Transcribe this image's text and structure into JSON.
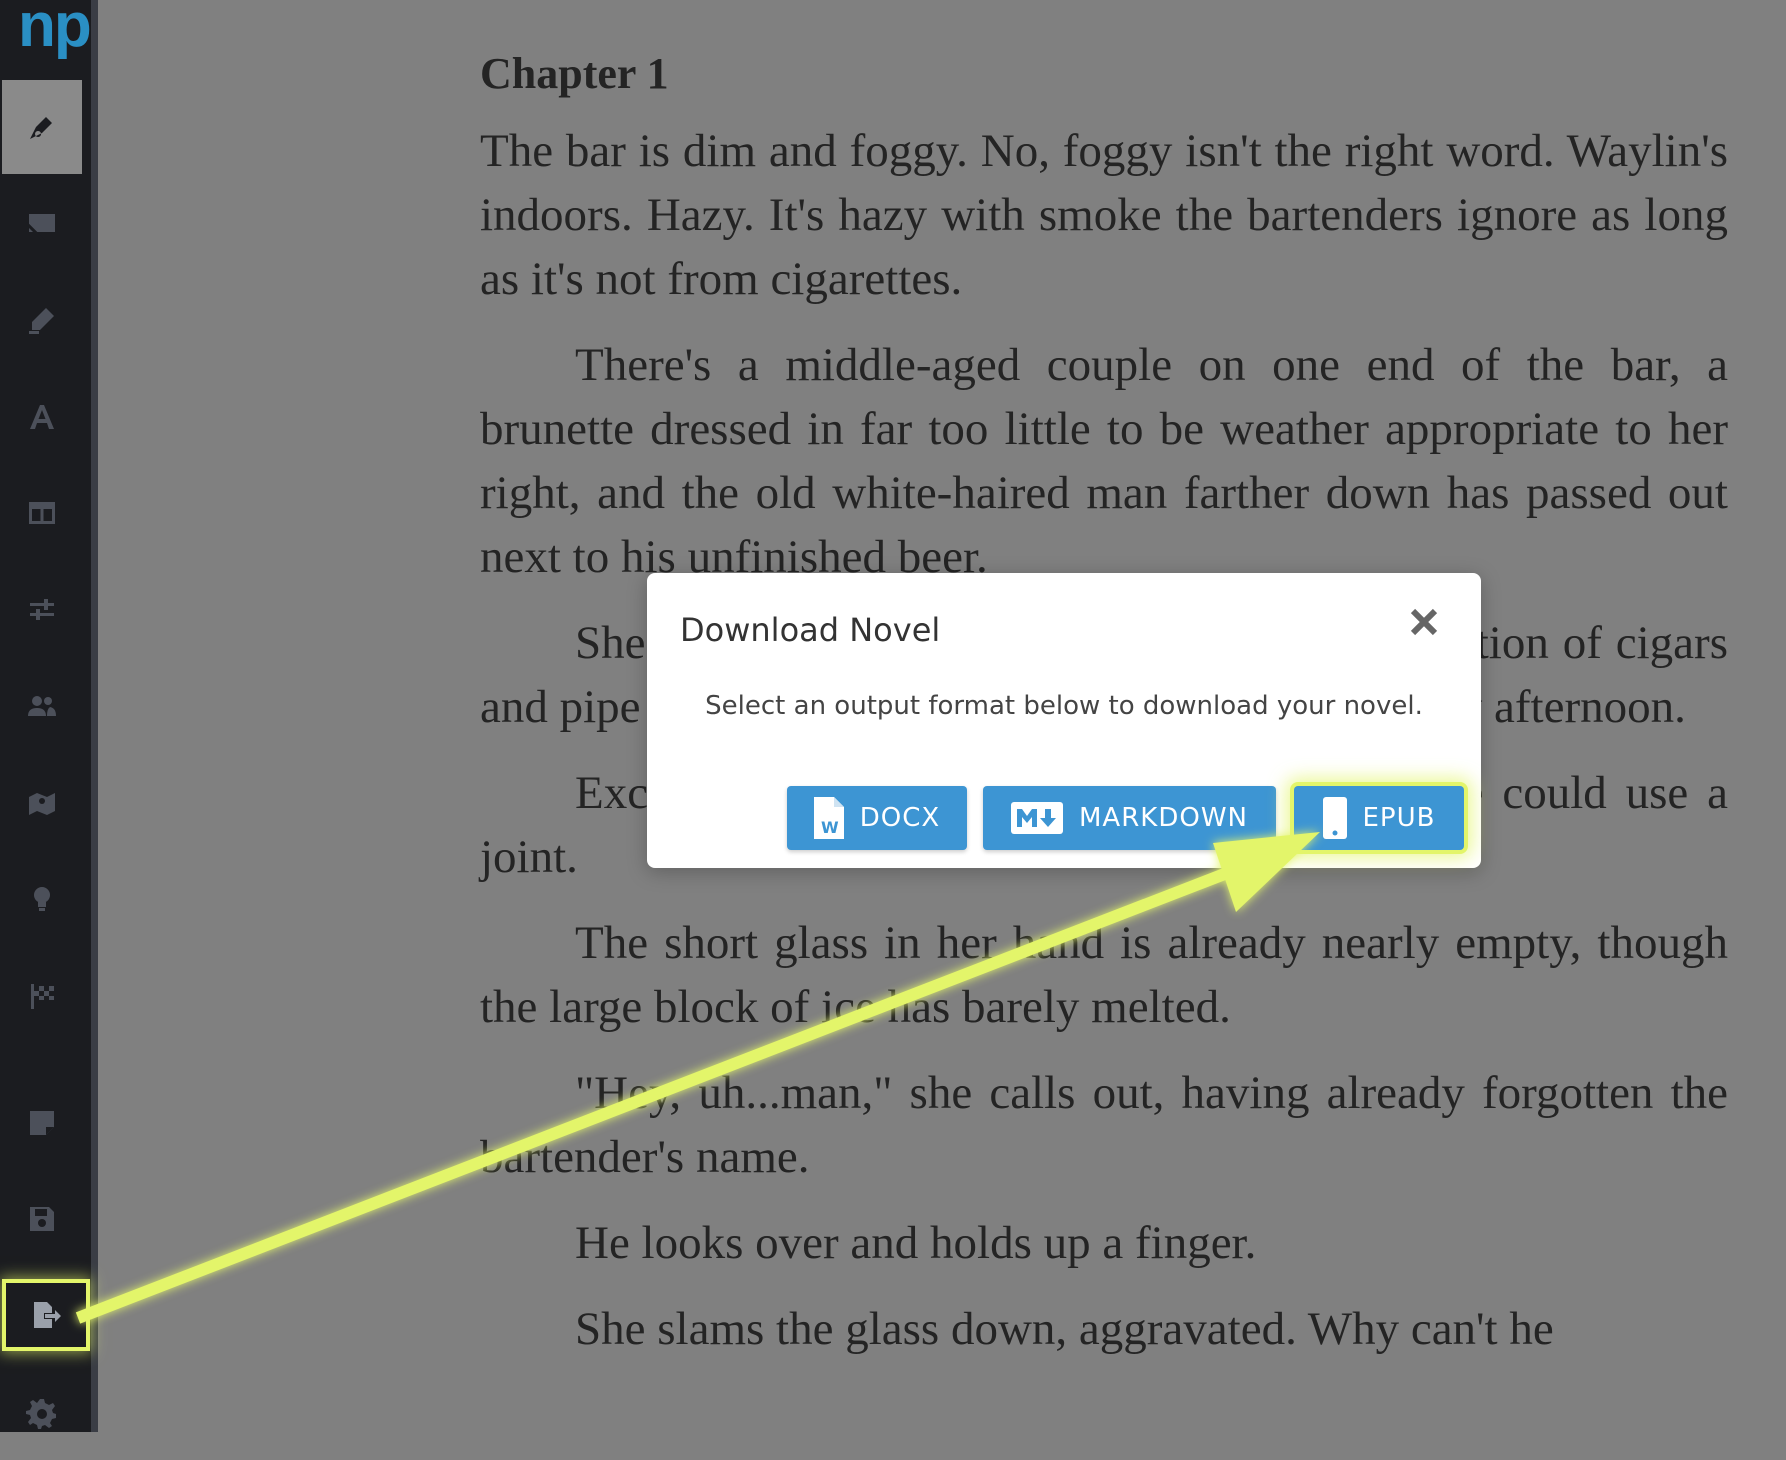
{
  "app": {
    "logo": "np"
  },
  "sidebar": {
    "items": [
      {
        "name": "write",
        "icon": "pen-nib-icon",
        "active": true
      },
      {
        "name": "distraction-free",
        "icon": "screen-off-icon"
      },
      {
        "name": "highlight",
        "icon": "marker-icon"
      },
      {
        "name": "font",
        "icon": "font-icon"
      },
      {
        "name": "layout",
        "icon": "columns-icon"
      },
      {
        "name": "sliders",
        "icon": "sliders-icon"
      },
      {
        "name": "characters",
        "icon": "users-icon"
      },
      {
        "name": "map",
        "icon": "map-icon"
      },
      {
        "name": "ideas",
        "icon": "lightbulb-icon"
      },
      {
        "name": "goals",
        "icon": "flag-checkered-icon"
      },
      {
        "name": "notes",
        "icon": "sticky-note-icon"
      },
      {
        "name": "save",
        "icon": "save-icon"
      },
      {
        "name": "export",
        "icon": "file-export-icon",
        "highlighted": true
      },
      {
        "name": "settings",
        "icon": "gear-icon"
      }
    ]
  },
  "document": {
    "chapter_title": "Chapter 1",
    "paragraphs": [
      "The bar is dim and foggy. No, foggy isn't the right word. Waylin's indoors. Hazy. It's hazy with smoke the bartenders ignore as long as it's not from cigarettes.",
      "There's a middle-aged couple on one end of the bar, a brunette dressed in far too little to be weather appropriate to her right, and the old white-haired man farther down has passed out next to his unfinished beer.",
      "She breathes deep, and the smoke is a combination of cigars and pipe tobacco, like her grandpa and a lazy Sunday afternoon.",
      "Except it's Friday. She thinks. Either way, she could use a joint.",
      "The short glass in her hand is already nearly empty, though the large block of ice has barely melted.",
      "\"Hey, uh...man,\" she calls out, having already forgotten the bartender's name.",
      "He looks over and holds up a finger.",
      "She slams the glass down, aggravated. Why can't he"
    ]
  },
  "modal": {
    "title": "Download Novel",
    "close_label": "×",
    "description": "Select an output format below to download your novel.",
    "buttons": [
      {
        "label": "DOCX",
        "icon": "word-file-icon"
      },
      {
        "label": "MARKDOWN",
        "icon": "markdown-icon"
      },
      {
        "label": "EPUB",
        "icon": "mobile-icon",
        "highlighted": true
      }
    ]
  },
  "colors": {
    "overlay": "#808080",
    "sidebar_bg": "#1b1c20",
    "button_blue": "#3d95d3",
    "highlight": "#e3f56a",
    "logo_blue": "#2a8fc4"
  }
}
